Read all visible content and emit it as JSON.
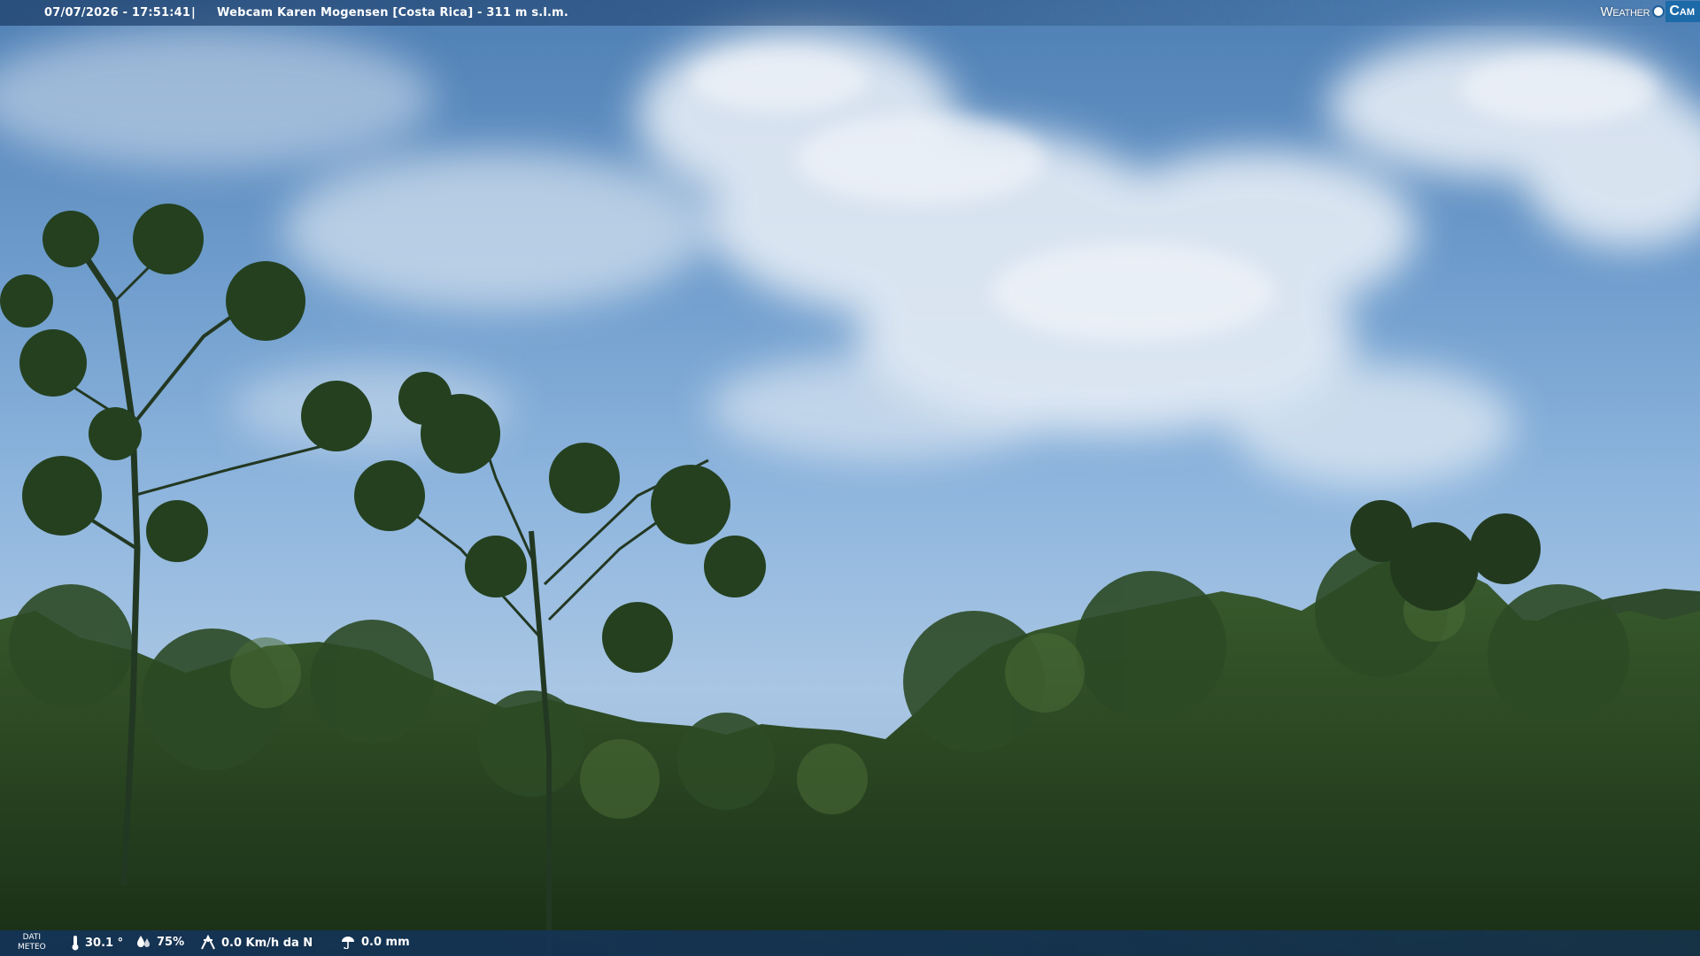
{
  "overlay": {
    "timestamp": "07/07/2026 - 17:51:41",
    "separator": "|",
    "camera_title": "Webcam Karen Mogensen [Costa Rica] - 311 m s.l.m."
  },
  "brand": {
    "weather_word": "Weather",
    "cam_word": "Cam",
    "accent_color": "#1c6aa8"
  },
  "meteo": {
    "label_line1": "DATI",
    "label_line2": "METEO",
    "temperature": "30.1 °",
    "humidity": "75%",
    "wind": "0.0 Km/h da N",
    "rain": "0.0 mm",
    "icons": [
      "thermometer-icon",
      "humidity-drop-icon",
      "wind-icon",
      "rain-icon"
    ]
  },
  "scene": {
    "sky_color": "#6e9ccc",
    "cloud_color": "#e8eef5",
    "foliage_color": "#1f3a1c"
  }
}
